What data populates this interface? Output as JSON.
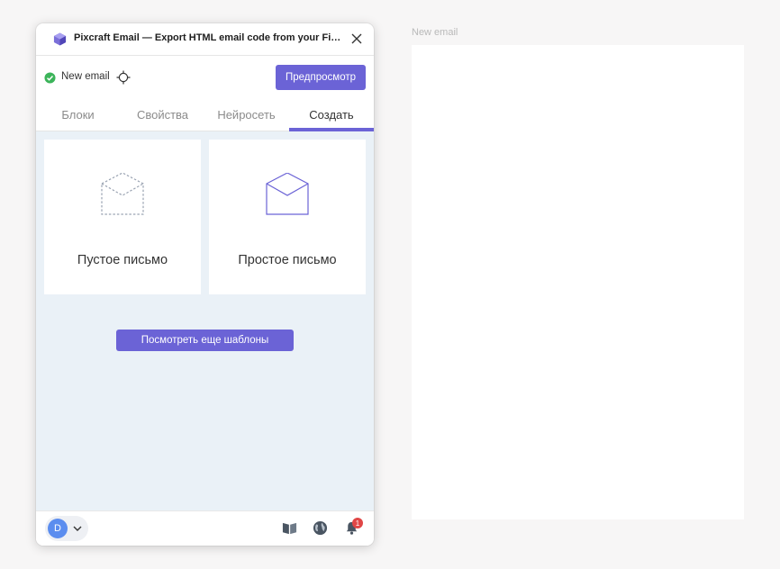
{
  "canvas": {
    "frame_label": "New email"
  },
  "plugin": {
    "title": "Pixcraft Email — Export HTML email code from your Figma...",
    "email_name": "New email",
    "preview_label": "Предпросмотр",
    "tabs": [
      {
        "label": "Блоки"
      },
      {
        "label": "Свойства"
      },
      {
        "label": "Нейросеть"
      },
      {
        "label": "Создать",
        "active": true
      }
    ],
    "templates": [
      {
        "label": "Пустое письмо",
        "icon": "empty-envelope-icon"
      },
      {
        "label": "Простое письмо",
        "icon": "simple-envelope-icon"
      }
    ],
    "more_templates_label": "Посмотреть еще шаблоны",
    "footer": {
      "avatar_initial": "D",
      "notification_count": "1",
      "icons": [
        "book-icon",
        "globe-icon",
        "bell-icon"
      ]
    }
  },
  "colors": {
    "accent": "#6b63d6",
    "content_bg": "#eaf1f7",
    "avatar": "#5b8def",
    "badge": "#e04646",
    "check": "#3cb45a"
  }
}
